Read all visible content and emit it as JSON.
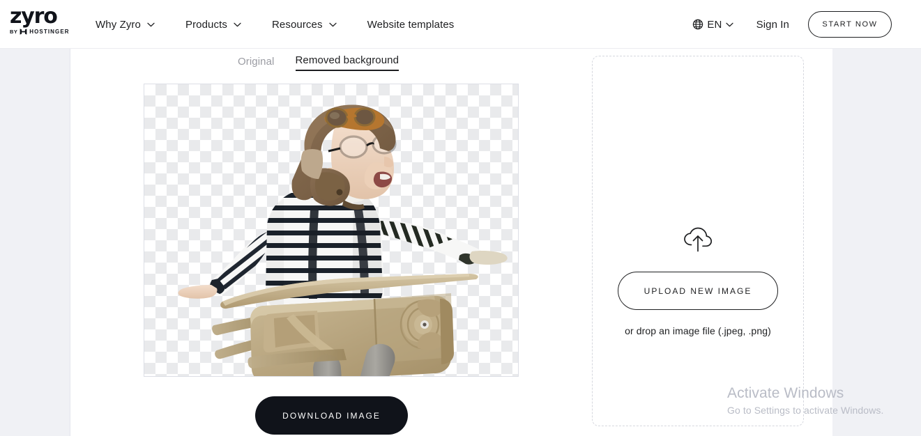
{
  "header": {
    "logo": {
      "word": "zyro",
      "by": "BY",
      "parent": "HOSTINGER",
      "icon": "hostinger-h-icon"
    },
    "nav": [
      {
        "label": "Why Zyro",
        "has_chevron": true
      },
      {
        "label": "Products",
        "has_chevron": true
      },
      {
        "label": "Resources",
        "has_chevron": true
      },
      {
        "label": "Website templates",
        "has_chevron": false
      }
    ],
    "language": {
      "label": "EN",
      "icon": "globe-icon",
      "has_chevron": true
    },
    "sign_in_label": "Sign In",
    "start_now_label": "START NOW"
  },
  "main": {
    "tabs": [
      {
        "label": "Original",
        "active": false
      },
      {
        "label": "Removed background",
        "active": true
      }
    ],
    "preview": {
      "alt": "Child in aviator cap and goggles sitting in a cardboard airplane, background removed showing transparency checkerboard",
      "transparency_checker": true
    },
    "download_label": "DOWNLOAD IMAGE"
  },
  "dropzone": {
    "icon": "cloud-upload-icon",
    "upload_label": "UPLOAD NEW IMAGE",
    "hint": "or drop an image file (.jpeg, .png)"
  },
  "watermark": {
    "title": "Activate Windows",
    "subtitle": "Go to Settings to activate Windows."
  },
  "colors": {
    "page_bg": "#f0f1f5",
    "panel_bg": "#ffffff",
    "text": "#1d1e20",
    "muted_text": "#9b9ca3",
    "accent_dark": "#10131a",
    "checker": "#e9eaec",
    "watermark": "#b9bcc6"
  }
}
